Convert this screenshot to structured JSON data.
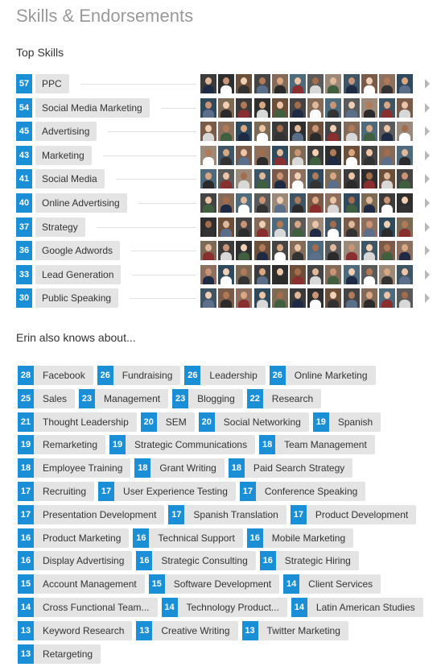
{
  "header": {
    "title": "Skills & Endorsements"
  },
  "top_skills_heading": "Top Skills",
  "also_heading": "Erin also knows about...",
  "colors": {
    "accent": "#1b8fd6",
    "pill": "#e4e4e4",
    "title": "#9a9a9a"
  },
  "top_skills": [
    {
      "count": "57",
      "label": "PPC"
    },
    {
      "count": "54",
      "label": "Social Media Marketing"
    },
    {
      "count": "45",
      "label": "Advertising"
    },
    {
      "count": "43",
      "label": "Marketing"
    },
    {
      "count": "41",
      "label": "Social Media"
    },
    {
      "count": "40",
      "label": "Online Advertising"
    },
    {
      "count": "37",
      "label": "Strategy"
    },
    {
      "count": "36",
      "label": "Google Adwords"
    },
    {
      "count": "33",
      "label": "Lead Generation"
    },
    {
      "count": "30",
      "label": "Public Speaking"
    }
  ],
  "also_rows": [
    [
      {
        "count": "28",
        "label": "Facebook"
      },
      {
        "count": "26",
        "label": "Fundraising"
      },
      {
        "count": "26",
        "label": "Leadership"
      },
      {
        "count": "26",
        "label": "Online Marketing"
      }
    ],
    [
      {
        "count": "25",
        "label": "Sales"
      },
      {
        "count": "23",
        "label": "Management"
      },
      {
        "count": "23",
        "label": "Blogging"
      },
      {
        "count": "22",
        "label": "Research"
      }
    ],
    [
      {
        "count": "21",
        "label": "Thought Leadership"
      },
      {
        "count": "20",
        "label": "SEM"
      },
      {
        "count": "20",
        "label": "Social Networking"
      },
      {
        "count": "19",
        "label": "Spanish"
      }
    ],
    [
      {
        "count": "19",
        "label": "Remarketing"
      },
      {
        "count": "19",
        "label": "Strategic Communications"
      },
      {
        "count": "18",
        "label": "Team Management"
      }
    ],
    [
      {
        "count": "18",
        "label": "Employee Training"
      },
      {
        "count": "18",
        "label": "Grant Writing"
      },
      {
        "count": "18",
        "label": "Paid Search Strategy"
      }
    ],
    [
      {
        "count": "17",
        "label": "Recruiting"
      },
      {
        "count": "17",
        "label": "User Experience Testing"
      },
      {
        "count": "17",
        "label": "Conference Speaking"
      }
    ],
    [
      {
        "count": "17",
        "label": "Presentation Development"
      },
      {
        "count": "17",
        "label": "Spanish Translation"
      },
      {
        "count": "17",
        "label": "Product Development"
      }
    ],
    [
      {
        "count": "16",
        "label": "Product Marketing"
      },
      {
        "count": "16",
        "label": "Technical Support"
      },
      {
        "count": "16",
        "label": "Mobile Marketing"
      }
    ],
    [
      {
        "count": "16",
        "label": "Display Advertising"
      },
      {
        "count": "16",
        "label": "Strategic Consulting"
      },
      {
        "count": "16",
        "label": "Strategic Hiring"
      }
    ],
    [
      {
        "count": "15",
        "label": "Account Management"
      },
      {
        "count": "15",
        "label": "Software Development"
      },
      {
        "count": "14",
        "label": "Client Services"
      }
    ],
    [
      {
        "count": "14",
        "label": "Cross Functional Team..."
      },
      {
        "count": "14",
        "label": "Technology Product..."
      },
      {
        "count": "14",
        "label": "Latin American Studies"
      }
    ],
    [
      {
        "count": "13",
        "label": "Keyword Research"
      },
      {
        "count": "13",
        "label": "Creative Writing"
      },
      {
        "count": "13",
        "label": "Twitter Marketing"
      }
    ],
    [
      {
        "count": "13",
        "label": "Retargeting"
      }
    ]
  ]
}
